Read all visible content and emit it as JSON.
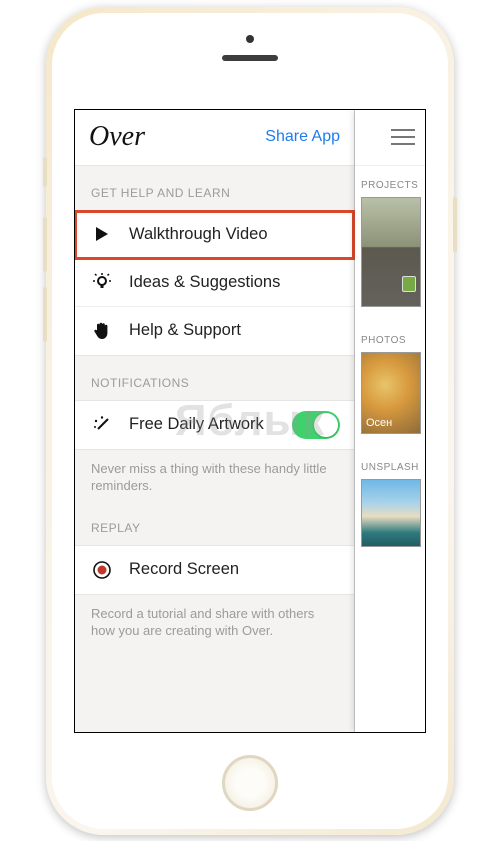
{
  "header": {
    "logo": "Over",
    "share": "Share App"
  },
  "sections": {
    "help": {
      "label": "GET HELP AND LEARN",
      "items": [
        {
          "label": "Walkthrough Video"
        },
        {
          "label": "Ideas & Suggestions"
        },
        {
          "label": "Help & Support"
        }
      ]
    },
    "notifications": {
      "label": "NOTIFICATIONS",
      "item": {
        "label": "Free Daily Artwork",
        "enabled": true
      },
      "desc": "Never miss a thing with these handy little reminders."
    },
    "replay": {
      "label": "REPLAY",
      "item": {
        "label": "Record Screen"
      },
      "desc": "Record a tutorial and share with others how you are creating with Over."
    }
  },
  "peek": {
    "sections": [
      {
        "label": "PROJECTS"
      },
      {
        "label": "PHOTOS"
      },
      {
        "label": "UNSPLASH"
      }
    ]
  },
  "watermark": "Яблык"
}
